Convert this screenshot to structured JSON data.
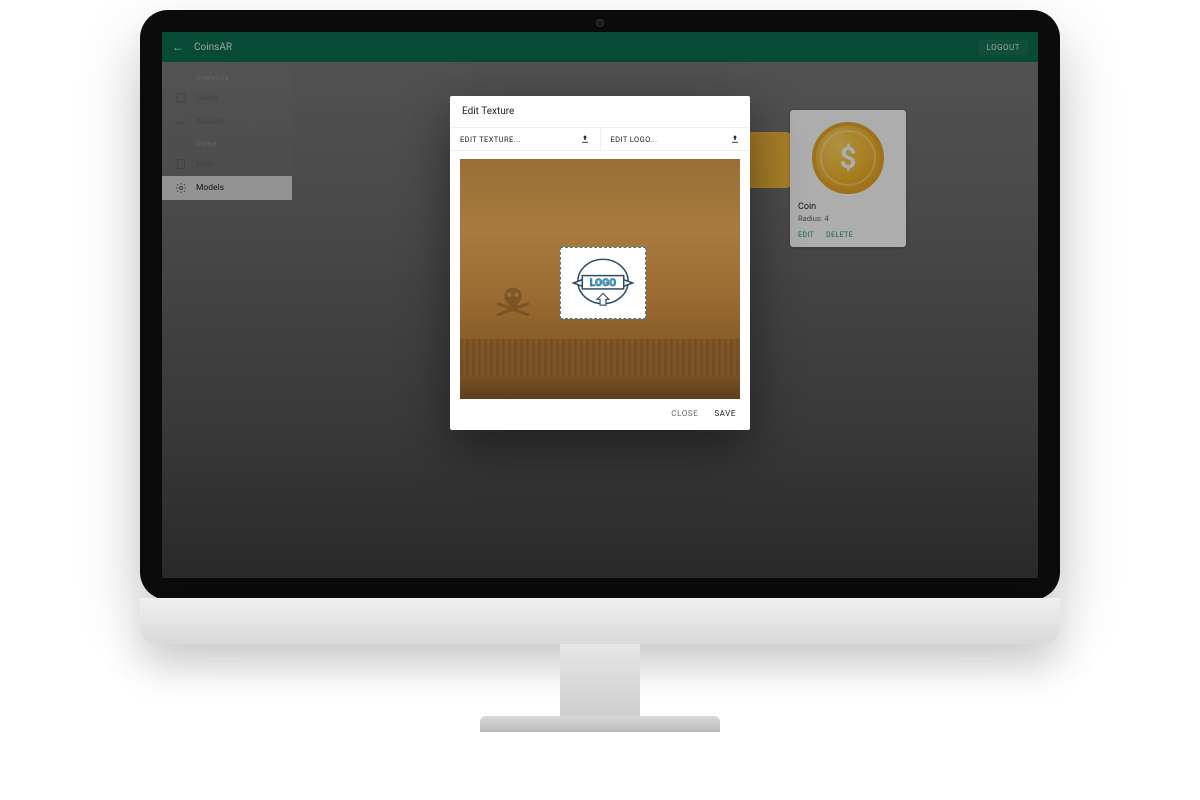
{
  "header": {
    "app_title": "CoinsAR",
    "logout": "LOGOUT"
  },
  "sidebar": {
    "sections": [
      {
        "label": "Analytics",
        "items": [
          {
            "icon": "users-icon",
            "label": "Users"
          },
          {
            "icon": "activity-icon",
            "label": "Activity"
          }
        ]
      },
      {
        "label": "Game",
        "items": [
          {
            "icon": "map-icon",
            "label": "Map"
          },
          {
            "icon": "models-icon",
            "label": "Models",
            "active": true
          }
        ]
      }
    ]
  },
  "card": {
    "title": "Coin",
    "subtitle": "Radius: 4",
    "edit": "EDIT",
    "delete": "DELETE"
  },
  "dialog": {
    "title": "Edit Texture",
    "edit_texture_btn": "EDIT TEXTURE...",
    "edit_logo_btn": "EDIT LOGO...",
    "logo_text": "LOGO",
    "close": "CLOSE",
    "save": "SAVE"
  }
}
